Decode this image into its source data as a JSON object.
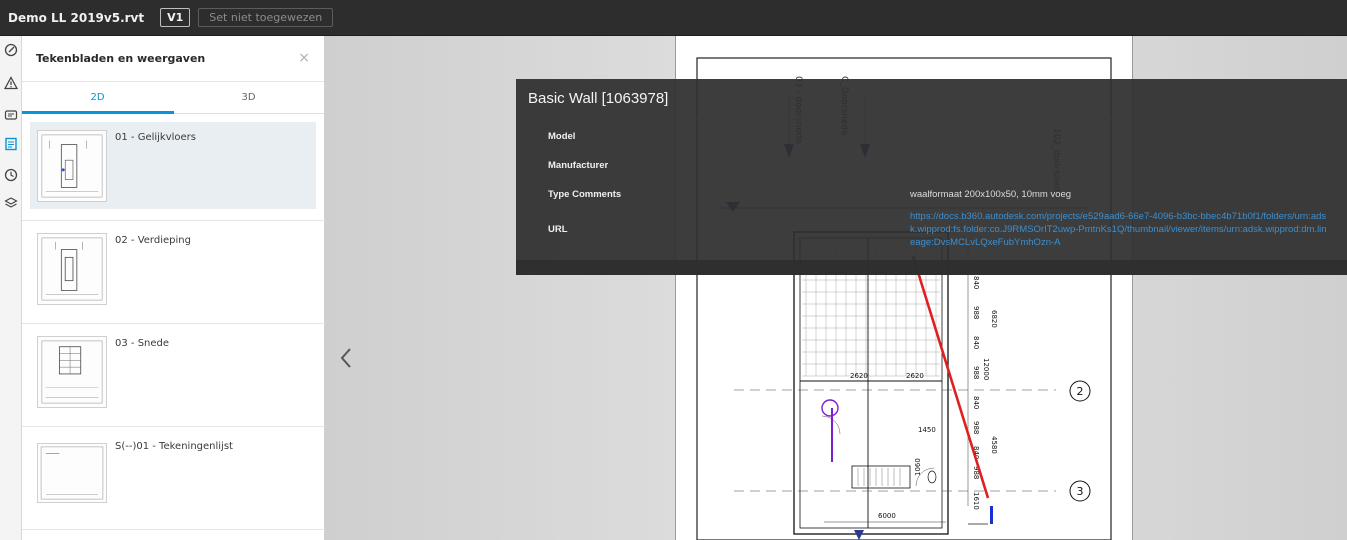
{
  "header": {
    "file_name": "Demo LL 2019v5.rvt",
    "version": "V1",
    "status": "Set niet toegewezen"
  },
  "iconstrip": {
    "icons": [
      "pencil-measure-icon",
      "warning-icon",
      "message-icon",
      "sheets-icon",
      "clock-icon",
      "layers-icon"
    ]
  },
  "panel": {
    "title": "Tekenbladen en weergaven",
    "close": "×",
    "tabs": [
      "2D",
      "3D"
    ],
    "sheets": [
      {
        "label": "01 - Gelijkvloers"
      },
      {
        "label": "02 - Verdieping"
      },
      {
        "label": "03 - Snede"
      },
      {
        "label": "S(--)01 - Tekeningenlijst"
      }
    ]
  },
  "properties": {
    "title": "Basic Wall [1063978]",
    "rows": [
      {
        "key": "Model",
        "value": ""
      },
      {
        "key": "Manufacturer",
        "value": ""
      },
      {
        "key": "Type Comments",
        "value": "waalformaat 200x100x50, 10mm voeg"
      },
      {
        "key": "URL",
        "value": "https://docs.b360.autodesk.com/projects/e529aad6-66e7-4096-b3bc-bbec4b71b0f1/folders/urn:adsk.wipprod:fs.folder:co.J9RMSOrIT2uwp-PmtnKs1Q/thumbnail/viewer/items/urn:adsk.wipprod:dm.lineage:DvsMCLvLQxeFubYmhOzn-A"
      }
    ]
  },
  "drawing": {
    "dims": [
      "2620",
      "2620",
      "1450",
      "1060",
      "6000",
      "840",
      "988",
      "840",
      "988",
      "840",
      "988",
      "840",
      "988",
      "1610",
      "12000",
      "6820",
      "4580"
    ],
    "grid_markers": [
      "2",
      "3"
    ],
    "section_labels": [
      "101_doorsnede A_Doorsnede 03",
      "101_doorsnede C_Doorsnede",
      "102_doorsnede B_Doorsnede"
    ]
  },
  "colors": {
    "accent": "#0696d7",
    "redline": "#e02020",
    "marker": "#7b1fd0"
  }
}
